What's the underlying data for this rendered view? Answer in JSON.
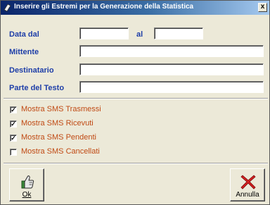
{
  "window": {
    "title": "Inserire gli Estremi per la Generazione della Statistica",
    "close_glyph": "x",
    "title_icon": "app-icon"
  },
  "form": {
    "date_from_label": "Data dal",
    "date_from_value": "",
    "date_to_label": "al",
    "date_to_value": "",
    "sender_label": "Mittente",
    "sender_value": "",
    "recipient_label": "Destinatario",
    "recipient_value": "",
    "text_part_label": "Parte del Testo",
    "text_part_value": ""
  },
  "options": [
    {
      "label": "Mostra SMS Trasmessi",
      "checked": true
    },
    {
      "label": "Mostra SMS Ricevuti",
      "checked": true
    },
    {
      "label": "Mostra SMS Pendenti",
      "checked": true
    },
    {
      "label": "Mostra SMS Cancellati",
      "checked": false
    }
  ],
  "buttons": {
    "ok_label": "Ok",
    "ok_icon": "thumbs-up-icon",
    "cancel_label": "Annulla",
    "cancel_icon": "red-x-icon"
  },
  "colors": {
    "label_blue": "#1e3ea8",
    "option_orange": "#c04a14",
    "title_bar": "#0a246a",
    "window_bg": "#ece9d8"
  }
}
